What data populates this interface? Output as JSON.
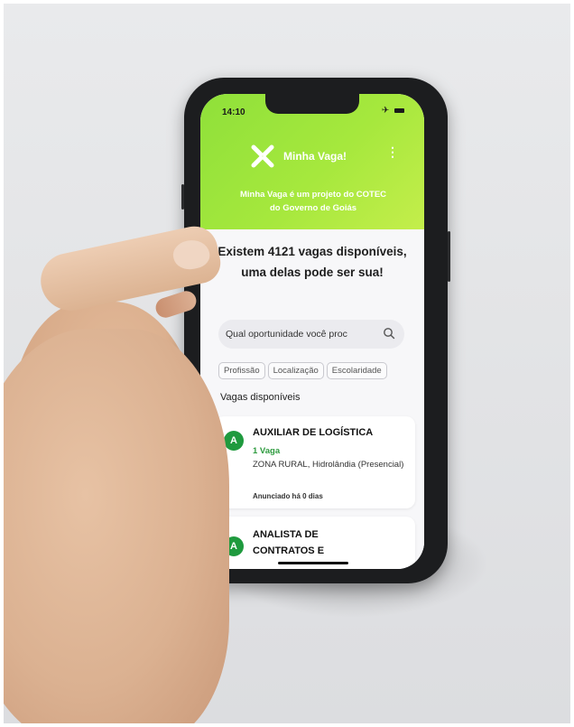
{
  "status_bar": {
    "time": "14:10",
    "icons": "✈"
  },
  "header": {
    "logo_icon": "x-logo-icon",
    "app_name": "Minha Vaga!",
    "menu_icon": "⋮",
    "subtitle": "Minha Vaga é um projeto do COTEC do Governo de Goiás"
  },
  "main": {
    "headline": "Existem 4121 vagas disponíveis, uma delas pode ser sua!",
    "search": {
      "placeholder": "Qual oportunidade você procura?",
      "visible_text": "Qual oportunidade você proc"
    },
    "filters": [
      "Profissão",
      "Localização",
      "Escolaridade"
    ],
    "section_title": "Vagas disponíveis"
  },
  "jobs": [
    {
      "avatar": "A",
      "title": "AUXILIAR DE LOGÍSTICA",
      "vacancies": "1 Vaga",
      "location": "ZONA RURAL, Hidrolândia (Presencial)",
      "posted": "Anunciado há 0 dias"
    },
    {
      "avatar": "A",
      "title": "ANALISTA DE CONTRATOS E"
    }
  ],
  "colors": {
    "header_gradient_start": "#8fe03a",
    "header_gradient_end": "#c4ee4b",
    "avatar_green": "#1f9a3e",
    "vacancy_green": "#2e9b3f",
    "phone_frame": "#1c1d1f"
  }
}
